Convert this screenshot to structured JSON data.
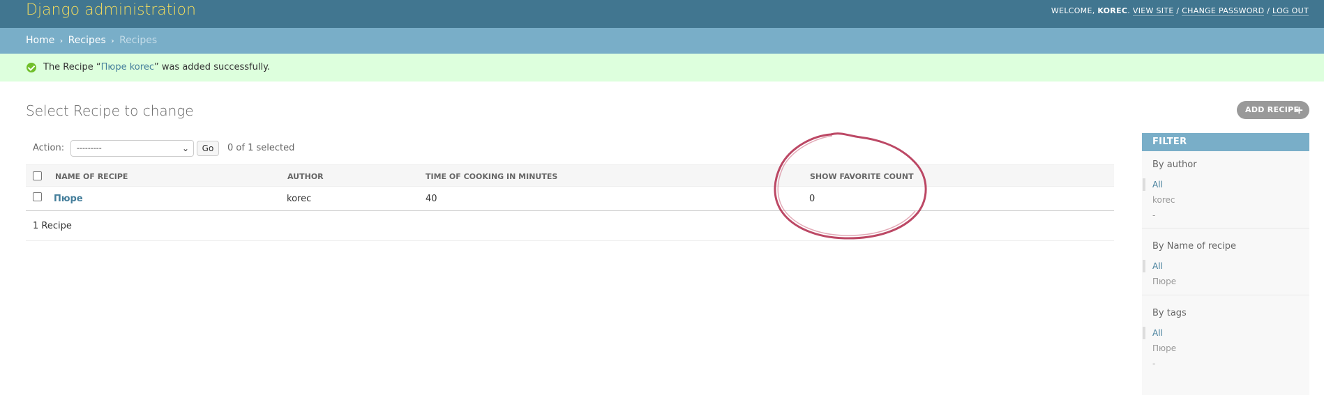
{
  "header": {
    "branding": "Django administration",
    "welcome": "WELCOME,",
    "username": "KOREC",
    "view_site": "VIEW SITE",
    "change_password": "CHANGE PASSWORD",
    "log_out": "LOG OUT",
    "sep": "/"
  },
  "breadcrumbs": {
    "home": "Home",
    "app": "Recipes",
    "current": "Recipes",
    "arrow": "›"
  },
  "message": {
    "prefix": "The Recipe “",
    "link": "Пюре korec",
    "suffix": "” was added successfully."
  },
  "content": {
    "title": "Select Recipe to change",
    "add_button": "ADD RECIPE",
    "add_icon": "+"
  },
  "actions": {
    "label": "Action:",
    "selected_option": "---------",
    "go": "Go",
    "selected_count": "0 of 1 selected"
  },
  "table": {
    "columns": [
      "NAME OF RECIPE",
      "AUTHOR",
      "TIME OF COOKING IN MINUTES",
      "SHOW FAVORITE COUNT"
    ],
    "rows": [
      {
        "name": "Пюре",
        "author": "korec",
        "time": "40",
        "favorite_count": "0"
      }
    ],
    "footer": "1 Recipe"
  },
  "filter": {
    "title": "FILTER",
    "groups": [
      {
        "heading": "By author",
        "items": [
          "All",
          "korec",
          "-"
        ]
      },
      {
        "heading": "By Name of recipe",
        "items": [
          "All",
          "Пюре"
        ]
      },
      {
        "heading": "By tags",
        "items": [
          "All",
          "Пюре",
          "-"
        ]
      }
    ]
  },
  "colors": {
    "header_bg": "#417690",
    "branding": "#f5dd5d",
    "breadcrumbs_bg": "#79aec8",
    "success_bg": "#ddffdd",
    "link": "#447e9b",
    "annotation": "#b0284a"
  },
  "annotation": {
    "shape": "hand-drawn circle around SHOW FAVORITE COUNT column"
  }
}
